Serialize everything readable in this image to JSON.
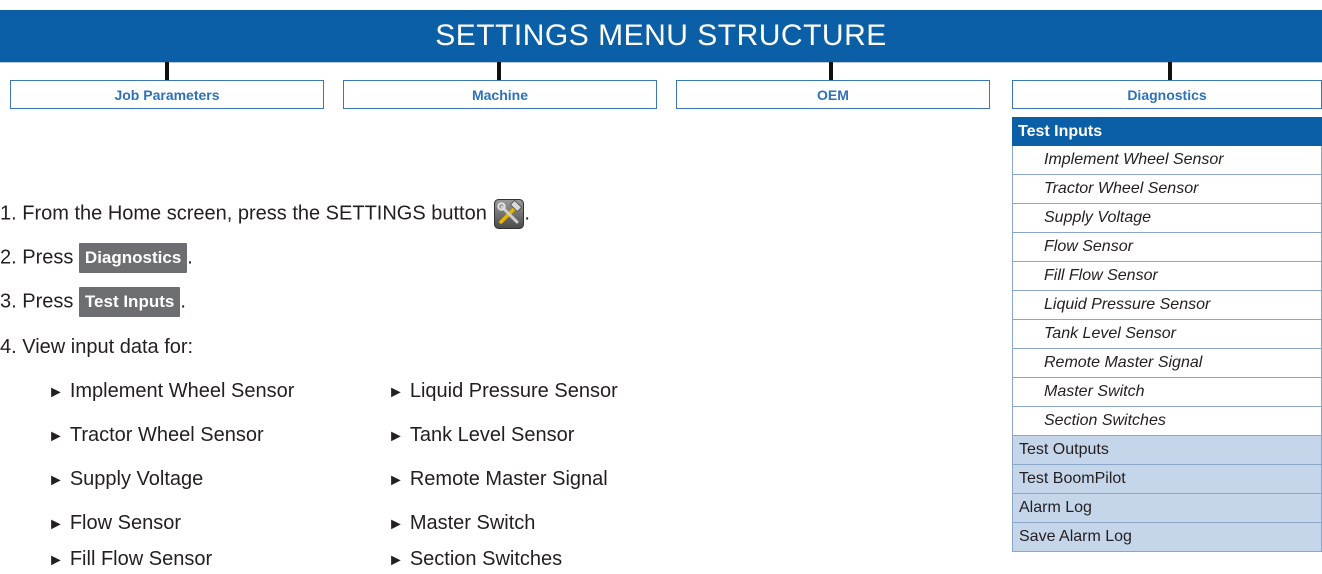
{
  "header": {
    "title": "SETTINGS MENU STRUCTURE"
  },
  "tabs": [
    "Job Parameters",
    "Machine",
    "OEM",
    "Diagnostics"
  ],
  "steps": {
    "step1_prefix": "1. From the Home screen, press the SETTINGS button",
    "step1_suffix": ".",
    "step2_prefix": "2. Press",
    "step2_button": "Diagnostics",
    "step2_suffix": ".",
    "step3_prefix": "3. Press",
    "step3_button": "Test Inputs",
    "step3_suffix": ".",
    "step4": "4. View input data for:"
  },
  "bullet_arrow": "►",
  "bullets_left": [
    "Implement Wheel Sensor",
    "Tractor Wheel Sensor",
    "Supply Voltage",
    "Flow Sensor",
    "Fill Flow Sensor"
  ],
  "bullets_right": [
    "Liquid Pressure Sensor",
    "Tank Level Sensor",
    "Remote Master Signal",
    "Master Switch",
    "Section Switches"
  ],
  "sidebar": {
    "heading": "Test Inputs",
    "subitems": [
      "Implement Wheel Sensor",
      "Tractor Wheel Sensor",
      "Supply Voltage",
      "Flow Sensor",
      "Fill Flow Sensor",
      "Liquid Pressure Sensor",
      "Tank Level Sensor",
      "Remote Master Signal",
      "Master Switch",
      "Section Switches"
    ],
    "items": [
      "Test Outputs",
      "Test BoomPilot",
      "Alarm Log",
      "Save Alarm Log"
    ]
  },
  "colors": {
    "header": "#0a5fa6",
    "tab_border": "#3a76b8",
    "sidebar_item": "#c6d6ea",
    "button_gray": "#6d6e71"
  },
  "icons": {
    "settings": "wrench-hammer-icon"
  }
}
